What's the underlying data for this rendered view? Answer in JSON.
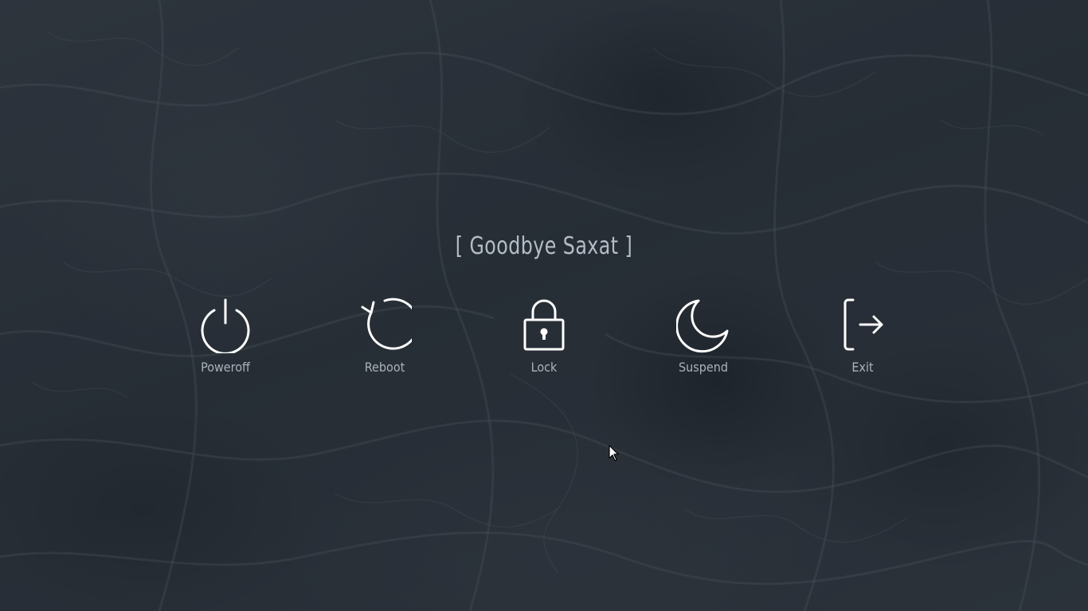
{
  "screen": {
    "title": "[ Goodbye Saxat ]"
  },
  "options": [
    {
      "id": "poweroff",
      "label": "Poweroff",
      "icon": "power-icon"
    },
    {
      "id": "reboot",
      "label": "Reboot",
      "icon": "reboot-icon"
    },
    {
      "id": "lock",
      "label": "Lock",
      "icon": "lock-icon"
    },
    {
      "id": "suspend",
      "label": "Suspend",
      "icon": "moon-icon"
    },
    {
      "id": "exit",
      "label": "Exit",
      "icon": "exit-icon"
    }
  ],
  "colors": {
    "icon": "#ffffff",
    "label": "#aab2bc",
    "title": "#b4bcc6",
    "background": "#2a343c"
  }
}
